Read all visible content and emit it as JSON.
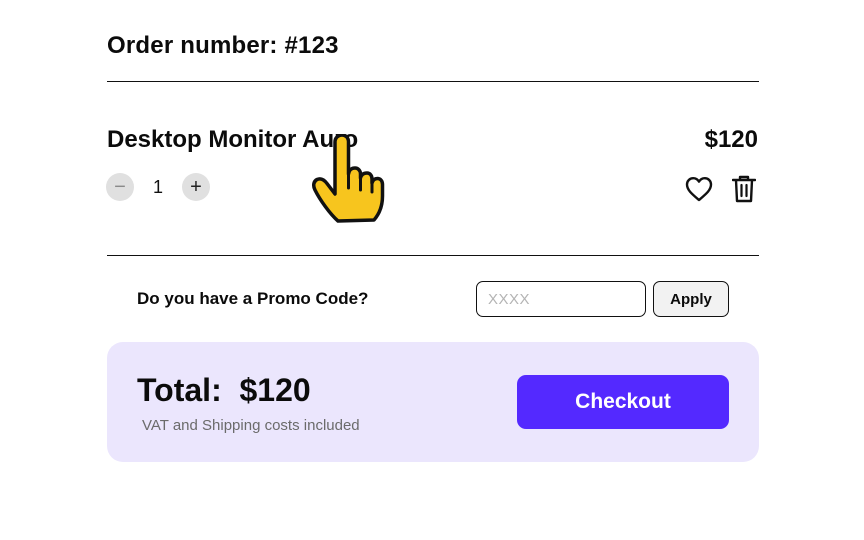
{
  "order": {
    "title": "Order number: #123"
  },
  "item": {
    "name": "Desktop Monitor Auro",
    "price": "$120",
    "quantity": "1",
    "decrease_icon": "minus-icon",
    "increase_icon": "plus-icon",
    "decrease_glyph": "−",
    "increase_glyph": "+",
    "favorite_icon": "heart-icon",
    "delete_icon": "trash-icon"
  },
  "promo": {
    "label": "Do you have a Promo Code?",
    "placeholder": "XXXX",
    "value": "",
    "apply_label": "Apply"
  },
  "summary": {
    "total_line": "Total:  $120",
    "note": "VAT and Shipping costs included",
    "checkout_label": "Checkout"
  },
  "colors": {
    "accent": "#5429ff",
    "card_background": "#ebe6fd",
    "cursor_fill": "#f7c51e"
  }
}
